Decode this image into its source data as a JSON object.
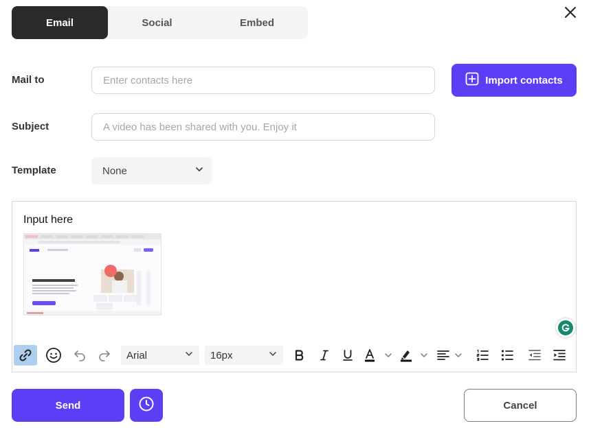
{
  "tabs": [
    {
      "label": "Email",
      "active": true
    },
    {
      "label": "Social",
      "active": false
    },
    {
      "label": "Embed",
      "active": false
    }
  ],
  "form": {
    "mail_to_label": "Mail to",
    "mail_to_placeholder": "Enter contacts here",
    "mail_to_value": "",
    "import_button_label": "Import contacts",
    "subject_label": "Subject",
    "subject_placeholder": "A video has been shared with you. Enjoy it",
    "subject_value": "",
    "template_label": "Template",
    "template_selected": "None"
  },
  "editor": {
    "body_text": "Input here",
    "thumbnail_icon": "video-screenshot-thumbnail"
  },
  "toolbar": {
    "font_family": "Arial",
    "font_size": "16px",
    "icons": [
      "link-icon",
      "emoji-icon",
      "undo-icon",
      "redo-icon",
      "bold-icon",
      "italic-icon",
      "underline-icon",
      "text-color-icon",
      "highlight-icon",
      "align-icon",
      "ordered-list-icon",
      "bullet-list-icon",
      "outdent-icon",
      "indent-icon"
    ]
  },
  "footer": {
    "send_label": "Send",
    "cancel_label": "Cancel",
    "schedule_icon": "clock-icon"
  },
  "colors": {
    "accent": "#5a3ff7",
    "active_tab": "#2b2b2b",
    "link_highlight": "#aed0ee",
    "grammarly": "#158a6a"
  }
}
